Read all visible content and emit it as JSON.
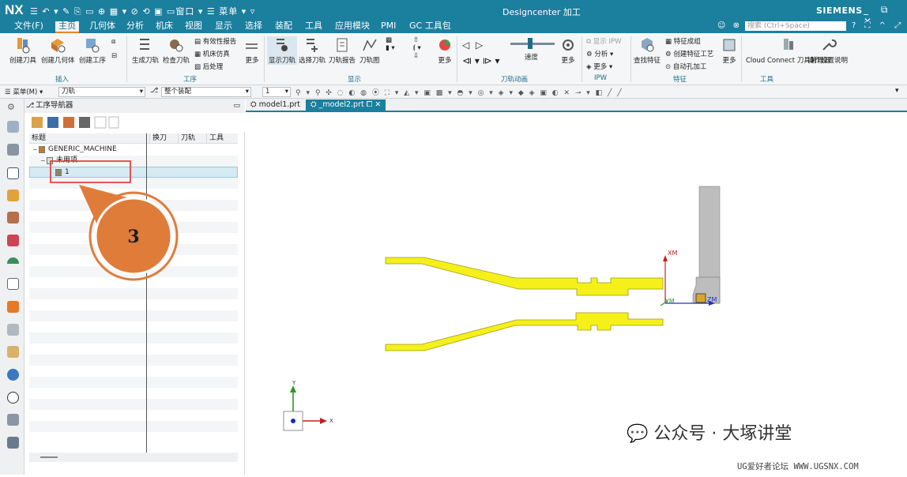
{
  "titlebar": {
    "logo": "NX",
    "quick_access": "☰ ↶ ▾ ✎ ⎘ ▭ ⊕ ▦ ▾ ⊘ ⟲ ▣ ▭窗口 ▾ ☰ 菜单 ▾ ▿",
    "title": "Designcenter 加工",
    "brand": "SIEMENS",
    "window_controls": "_ ⧉ ✕"
  },
  "menu": {
    "items": [
      "文件(F)",
      "主页",
      "几何体",
      "分析",
      "机床",
      "视图",
      "显示",
      "选择",
      "装配",
      "工具",
      "应用模块",
      "PMI",
      "GC 工具包"
    ],
    "search_placeholder": "搜索 (Ctrl+Space)",
    "right_icons": "☺ ⊗",
    "right_icons2": "? ⛶ ^ ⤢"
  },
  "ribbon": {
    "insert_group": "插入",
    "insert_buttons": [
      "创建刀具",
      "创建几何体",
      "创建工序"
    ],
    "op_group": "工序",
    "op_buttons": [
      "生成刀轨",
      "检查刀轨"
    ],
    "op_small": [
      "有效性报告",
      "机床仿真",
      "后处理"
    ],
    "more": "更多",
    "display_group": "显示",
    "display_buttons": [
      "显示刀轨",
      "选择刀轨",
      "刀轨报告",
      "刀轨图"
    ],
    "anim_group": "刀轨动画",
    "anim_speed": "速度",
    "ipw_group": "IPW",
    "ipw_small": [
      "显示 IPW",
      "分析",
      "更多"
    ],
    "feature_group": "特征",
    "feature_button": "查找特征",
    "feature_small": [
      "特征成组",
      "创建特征工艺",
      "自动孔加工"
    ],
    "tools_group": "工具",
    "tools_button": "Cloud Connect 刀具管理器",
    "tools_button2": "操作设置说明"
  },
  "toolbar2": {
    "menu": "☰ 菜单(M) ▾",
    "filter": "刀轨",
    "scope": "整个装配",
    "num": "1"
  },
  "navigator": {
    "title": "工序导航器",
    "columns": [
      "标题",
      "换刀",
      "刀轨",
      "工具"
    ],
    "rows": [
      {
        "label": "GENERIC_MACHINE",
        "indent": 0
      },
      {
        "label": "未用项",
        "indent": 1
      },
      {
        "label": "1",
        "indent": 2
      }
    ]
  },
  "tabs": [
    {
      "label": "model1.prt",
      "active": false
    },
    {
      "label": "_model2.prt",
      "active": true
    }
  ],
  "canvas": {
    "callout_number": "3",
    "wcs_labels": {
      "xm": "XM",
      "ym": "YM",
      "zm": "ZM"
    },
    "triad_labels": {
      "x": "X",
      "y": "Y"
    },
    "watermark": "公众号 · 大塚讲堂",
    "footer_url": "UG爱好者论坛 WWW.UGSNX.COM"
  },
  "colors": {
    "titlebar": "#1b7f9e",
    "accent_orange": "#e8862a",
    "callout_fill": "#e07c3a",
    "part_yellow": "#f5f01a",
    "selection_red": "#e53030"
  }
}
